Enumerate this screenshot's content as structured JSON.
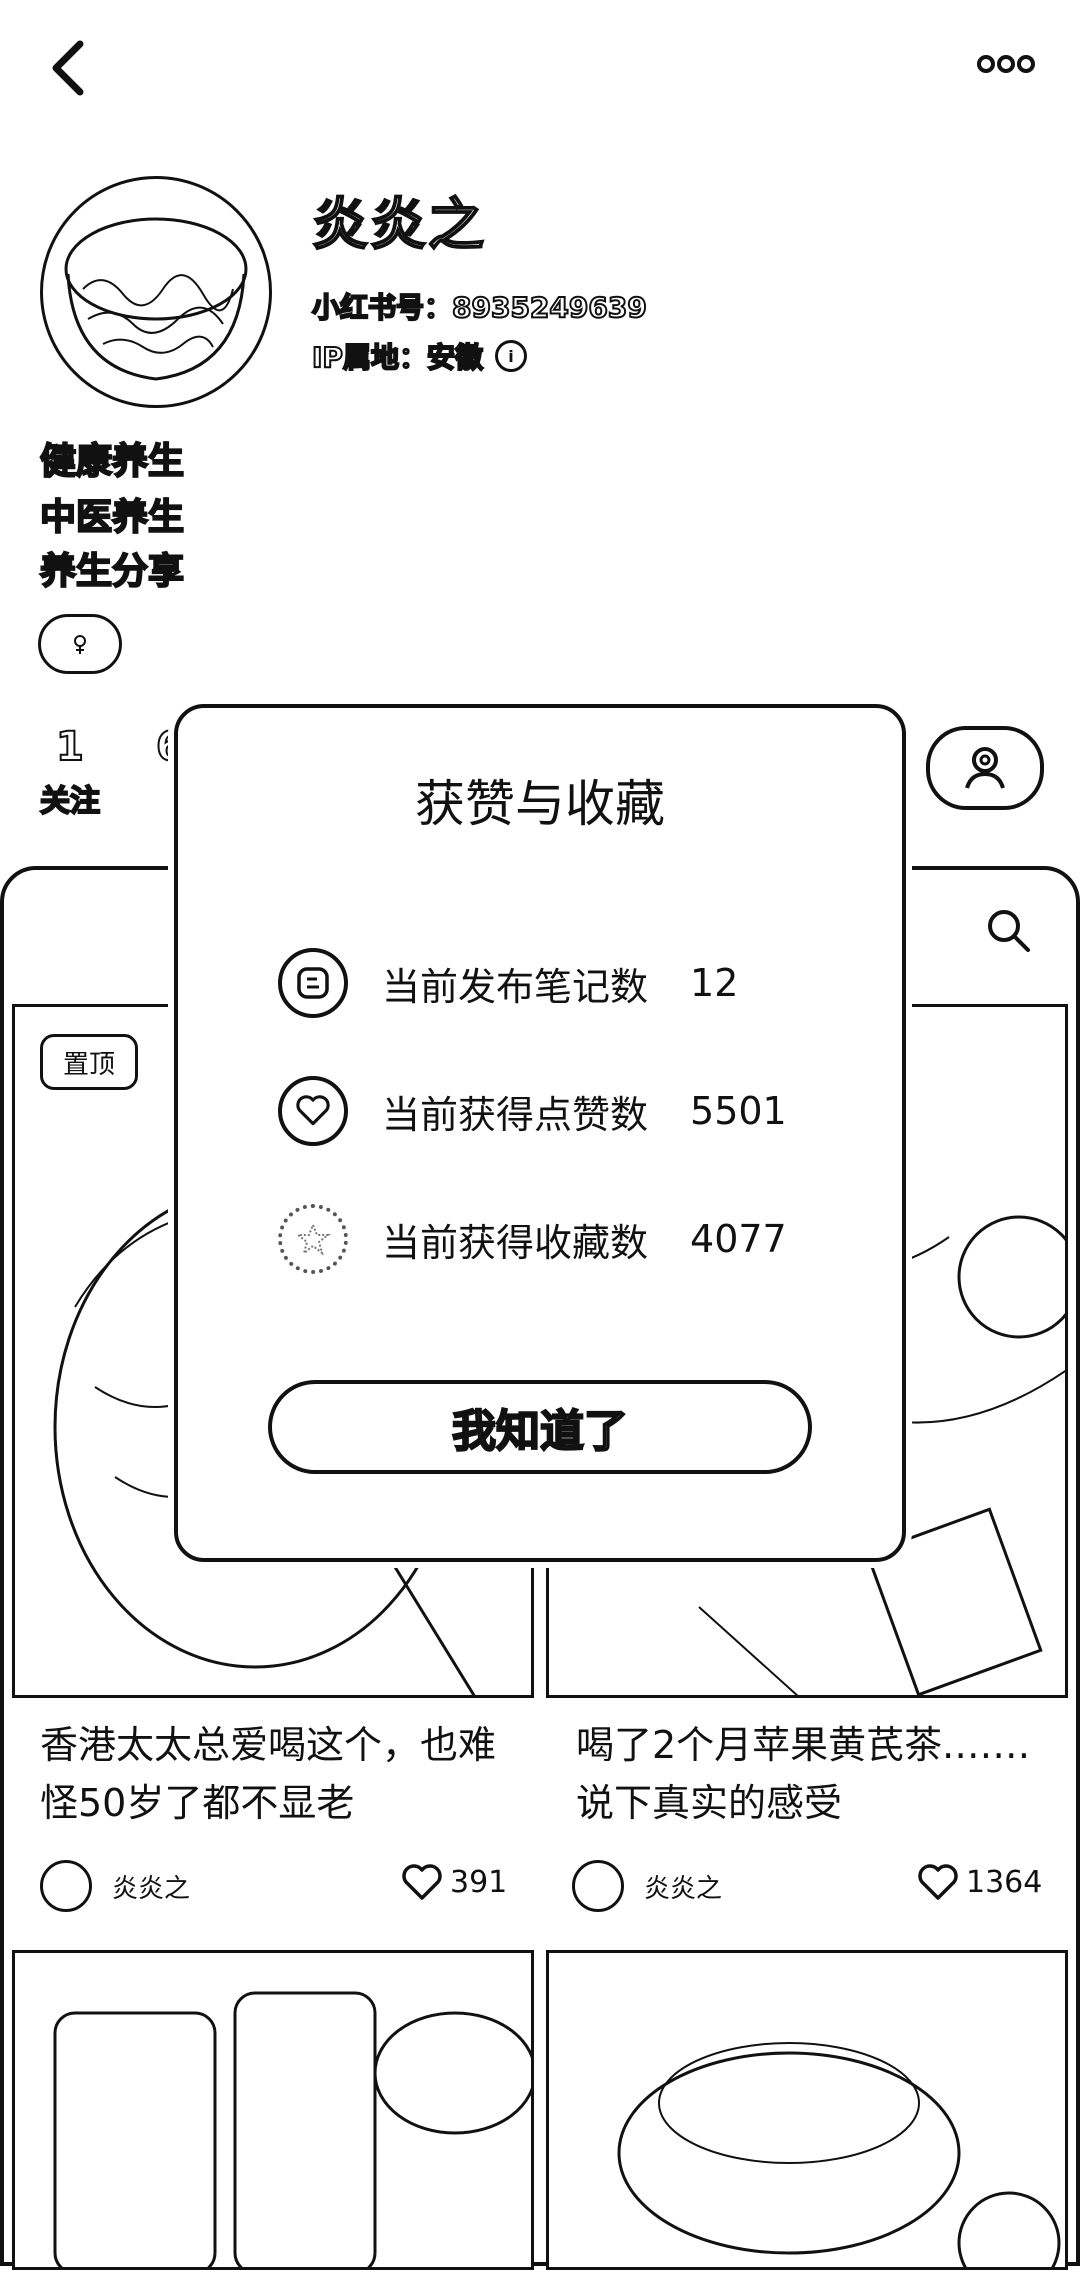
{
  "profile": {
    "name": "炎炎之",
    "red_id": "小红书号：8935249639",
    "ip": "IP属地：安徽",
    "bio": [
      "健康养生",
      "中医养生",
      "养生分享"
    ]
  },
  "stats": {
    "follow_num": "1",
    "follow_label": "关注",
    "fans_num_partial": "6"
  },
  "feed": {
    "pin_label": "置顶",
    "cards": [
      {
        "title": "香港太太总爱喝这个，也难怪50岁了都不显老",
        "author": "炎炎之",
        "likes": "391"
      },
      {
        "title": "喝了2个月苹果黄芪茶.……说下真实的感受",
        "author": "炎炎之",
        "likes": "1364"
      }
    ]
  },
  "dialog": {
    "title": "获赞与收藏",
    "rows": [
      {
        "label": "当前发布笔记数",
        "value": "12",
        "icon": "note-icon"
      },
      {
        "label": "当前获得点赞数",
        "value": "5501",
        "icon": "heart-icon"
      },
      {
        "label": "当前获得收藏数",
        "value": "4077",
        "icon": "star-icon"
      }
    ],
    "ok_label": "我知道了"
  }
}
